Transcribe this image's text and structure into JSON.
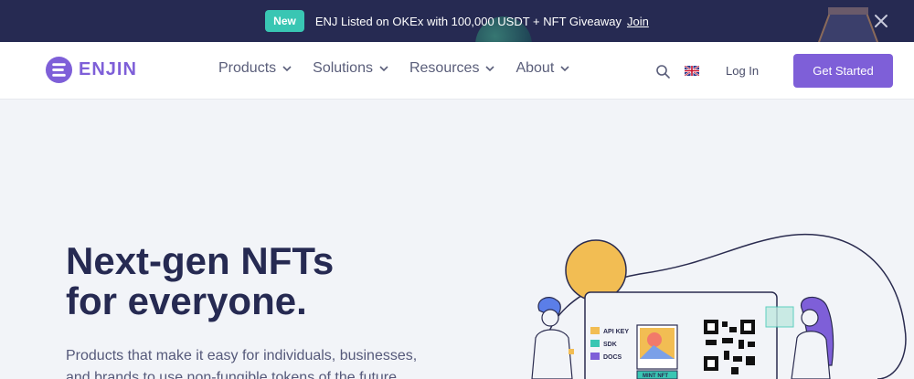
{
  "announcement": {
    "badge": "New",
    "text": "ENJ Listed on OKEx with 100,000 USDT + NFT Giveaway",
    "link": "Join"
  },
  "nav": {
    "logo_text": "ENJIN",
    "menu": [
      {
        "label": "Products"
      },
      {
        "label": "Solutions"
      },
      {
        "label": "Resources"
      },
      {
        "label": "About"
      }
    ],
    "login": "Log In",
    "cta": "Get Started"
  },
  "hero": {
    "title_line1": "Next-gen NFTs",
    "title_line2": "for everyone.",
    "subtitle": "Products that make it easy for individuals, businesses, and brands to use non-fungible tokens of the future."
  },
  "illustration": {
    "labels": [
      "API KEY",
      "SDK",
      "DOCS"
    ],
    "mint_label": "MINT NFT"
  },
  "colors": {
    "brand": "#7e5fd8",
    "announce_bg": "#262a52",
    "badge": "#39c6b3",
    "sun": "#f2bd53"
  }
}
